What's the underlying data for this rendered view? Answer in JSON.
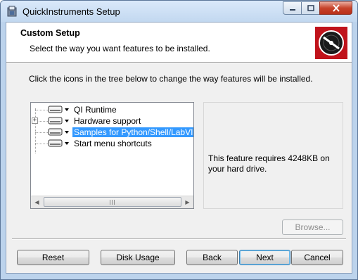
{
  "window": {
    "title": "QuickInstruments Setup"
  },
  "banner": {
    "title": "Custom Setup",
    "subtitle": "Select the way you want features to be installed."
  },
  "instruction": "Click the icons in the tree below to change the way features will be installed.",
  "tree": {
    "items": [
      {
        "label": "QI Runtime",
        "icon": "drive-icon",
        "selected": false
      },
      {
        "label": "Hardware support",
        "icon": "drive-icon",
        "selected": false,
        "expandable": true
      },
      {
        "label": "Samples for Python/Shell/LabVIEW",
        "icon": "drive-icon",
        "selected": true
      },
      {
        "label": "Start menu shortcuts",
        "icon": "drive-icon",
        "selected": false
      }
    ],
    "expander_symbol": "+"
  },
  "info": {
    "text": "This feature requires 4248KB on your hard drive."
  },
  "buttons": {
    "browse": "Browse...",
    "reset": "Reset",
    "disk_usage": "Disk Usage",
    "back": "Back",
    "next": "Next",
    "cancel": "Cancel"
  },
  "colors": {
    "selection": "#3399ff",
    "logo": "#c0131b",
    "close": "#c7432b"
  }
}
